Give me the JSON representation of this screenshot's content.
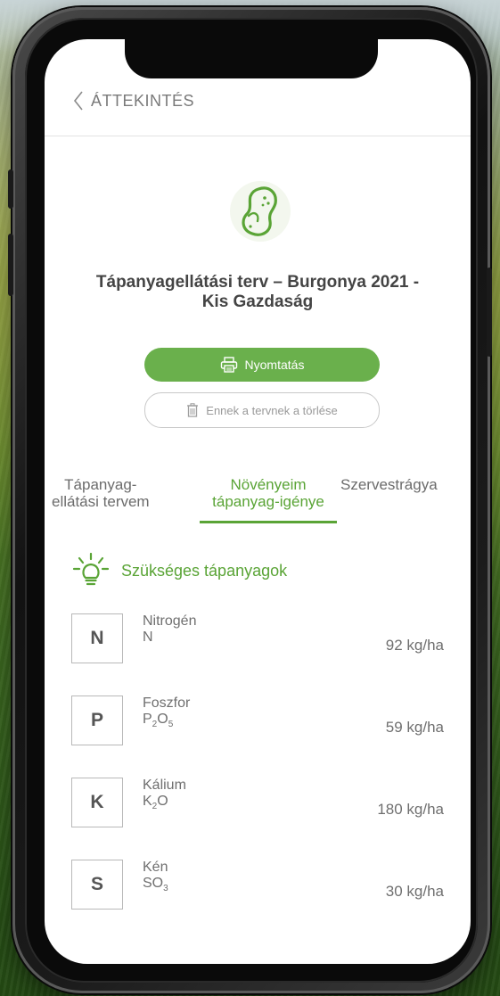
{
  "header": {
    "back_label": "ÁTTEKINTÉS"
  },
  "plan": {
    "title_line1": "Tápanyagellátási terv – Burgonya 2021 -",
    "title_line2": "Kis Gazdaság"
  },
  "actions": {
    "print_label": "Nyomtatás",
    "delete_label": "Ennek a tervnek a törlése"
  },
  "tabs": [
    {
      "line1": "Tápanyag-",
      "line2": "ellátási tervem",
      "active": false
    },
    {
      "line1": "Növényeim",
      "line2": "tápanyag-igénye",
      "active": true
    },
    {
      "line1": "Szervestrágya",
      "line2": "",
      "active": false
    }
  ],
  "section": {
    "title": "Szükséges tápanyagok"
  },
  "nutrients": [
    {
      "symbol": "N",
      "name": "Nitrogén",
      "formula": "N",
      "value": "92 kg/ha"
    },
    {
      "symbol": "P",
      "name": "Foszfor",
      "formula_main": "P",
      "formula_sub1": "2",
      "formula_mid": "O",
      "formula_sub2": "5",
      "value": "59 kg/ha"
    },
    {
      "symbol": "K",
      "name": "Kálium",
      "formula_main": "K",
      "formula_sub1": "2",
      "formula_mid": "O",
      "formula_sub2": "",
      "value": "180 kg/ha"
    },
    {
      "symbol": "S",
      "name": "Kén",
      "formula_main": "SO",
      "formula_sub1": "3",
      "formula_mid": "",
      "formula_sub2": "",
      "value": "30 kg/ha"
    }
  ],
  "colors": {
    "accent": "#5aa436",
    "button_green": "#6ab04c"
  },
  "icons": [
    "chevron-left-icon",
    "potato-icon",
    "printer-icon",
    "trash-icon",
    "lightbulb-icon"
  ]
}
